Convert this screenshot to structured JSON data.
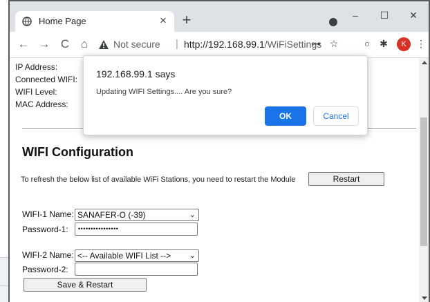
{
  "browser": {
    "tab_title": "Home Page",
    "tab_close": "×",
    "new_tab": "+",
    "window_controls": {
      "minimize": "–",
      "maximize": "☐",
      "close": "✕"
    },
    "toolbar": {
      "back": "←",
      "forward": "→",
      "reload": "C",
      "home": "⌂"
    },
    "security_label": "Not secure",
    "separator": "|",
    "url_host": "http://192.168.99.1",
    "url_path": "/WiFiSettings",
    "extensions": {
      "key": "⊶",
      "star": "☆",
      "circle": "○",
      "puzzle": "✱",
      "menu": "⋮"
    },
    "avatar_letter": "K",
    "accent_color": "#1a73e8",
    "avatar_color": "#d93025"
  },
  "page": {
    "info_labels": [
      "IP Address:",
      "Connected WIFI:",
      "WIFI Level:",
      "MAC Address:"
    ],
    "config_title": "WIFI Configuration",
    "restart_hint": "To refresh the below list of available WiFi Stations, you need to restart the Module",
    "restart_button": "Restart",
    "wifi1": {
      "name_label": "WIFI-1 Name:",
      "selected": "SANAFER-O (-39)",
      "password_label": "Password-1:",
      "password_value": "••••••••••••••••"
    },
    "wifi2": {
      "name_label": "WIFI-2 Name:",
      "selected": "<-- Available WIFI List -->",
      "password_label": "Password-2:",
      "password_value": ""
    },
    "save_button": "Save & Restart"
  },
  "dialog": {
    "title": "192.168.99.1 says",
    "message": "Updating WIFI Settings.... Are you sure?",
    "ok_label": "OK",
    "cancel_label": "Cancel"
  }
}
